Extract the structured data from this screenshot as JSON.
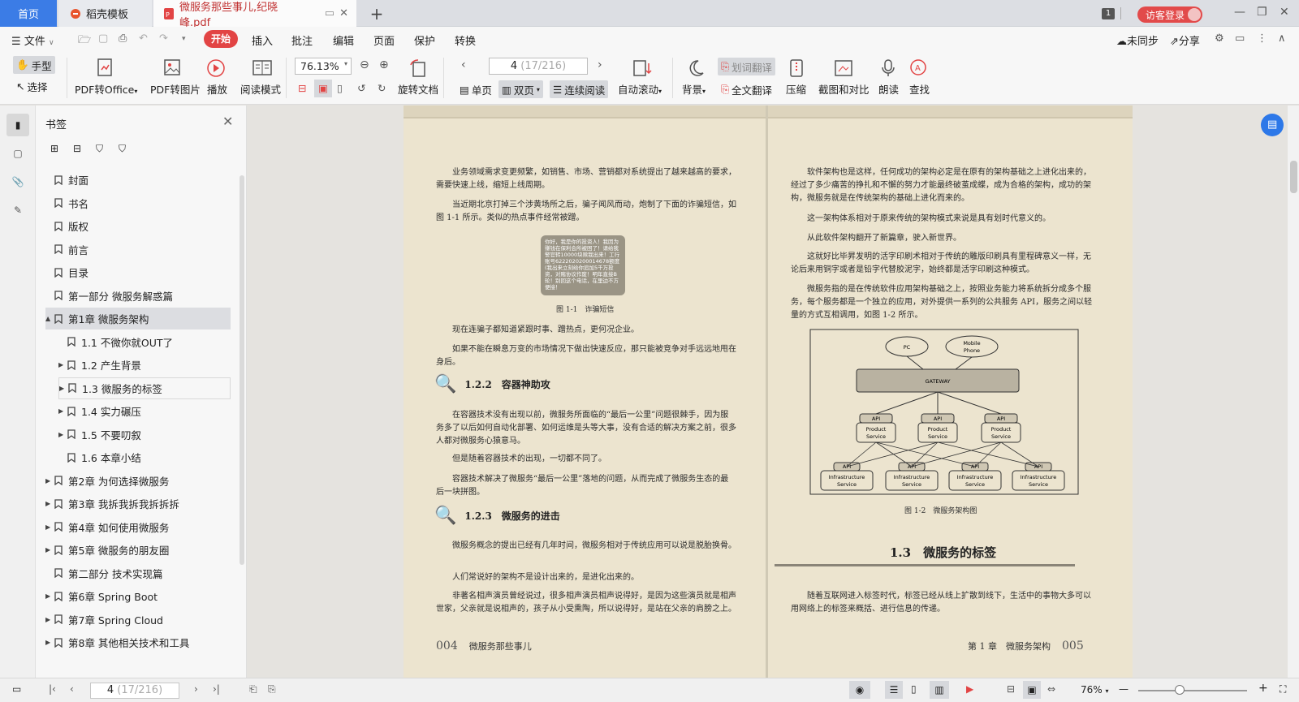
{
  "tabs": {
    "home": "首页",
    "template": "稻壳模板",
    "pdf": "微服务那些事儿,纪晓峰.pdf",
    "add": "+"
  },
  "titlebar": {
    "notif_count": "1",
    "login": "访客登录"
  },
  "menu": {
    "file": "文件",
    "start": "开始",
    "insert": "插入",
    "annotate": "批注",
    "edit": "编辑",
    "page": "页面",
    "protect": "保护",
    "convert": "转换",
    "unsync": "未同步",
    "share": "分享"
  },
  "toolbar": {
    "hand": "手型",
    "select": "选择",
    "pdf_to_office": "PDF转Office",
    "pdf_to_image": "PDF转图片",
    "play": "播放",
    "read_mode": "阅读模式",
    "zoom": "76.13%",
    "rotate": "旋转文档",
    "page_current": "4",
    "page_total": "(17/216)",
    "single": "单页",
    "double": "双页",
    "continuous": "连续阅读",
    "autoscroll": "自动滚动",
    "background": "背景",
    "word_translate": "划词翻译",
    "full_translate": "全文翻译",
    "compress": "压缩",
    "screenshot": "截图和对比",
    "read_aloud": "朗读",
    "find": "查找"
  },
  "panel": {
    "title": "书签",
    "items": [
      {
        "label": "封面",
        "level": 0,
        "expand": ""
      },
      {
        "label": "书名",
        "level": 0,
        "expand": ""
      },
      {
        "label": "版权",
        "level": 0,
        "expand": ""
      },
      {
        "label": "前言",
        "level": 0,
        "expand": ""
      },
      {
        "label": "目录",
        "level": 0,
        "expand": ""
      },
      {
        "label": "第一部分 微服务解惑篇",
        "level": 0,
        "expand": ""
      },
      {
        "label": "第1章 微服务架构",
        "level": 0,
        "expand": "▲"
      },
      {
        "label": "1.1 不微你就OUT了",
        "level": 1,
        "expand": ""
      },
      {
        "label": "1.2 产生背景",
        "level": 1,
        "expand": "▶"
      },
      {
        "label": "1.3 微服务的标签",
        "level": 1,
        "expand": "▶"
      },
      {
        "label": "1.4 实力碾压",
        "level": 1,
        "expand": "▶"
      },
      {
        "label": "1.5 不要叨叙",
        "level": 1,
        "expand": "▶"
      },
      {
        "label": "1.6 本章小结",
        "level": 1,
        "expand": ""
      },
      {
        "label": "第2章 为何选择微服务",
        "level": 0,
        "expand": "▶"
      },
      {
        "label": "第3章 我拆我拆我拆拆拆",
        "level": 0,
        "expand": "▶"
      },
      {
        "label": "第4章 如何使用微服务",
        "level": 0,
        "expand": "▶"
      },
      {
        "label": "第5章 微服务的朋友圈",
        "level": 0,
        "expand": "▶"
      },
      {
        "label": "第二部分 技术实现篇",
        "level": 0,
        "expand": ""
      },
      {
        "label": "第6章 Spring Boot",
        "level": 0,
        "expand": "▶"
      },
      {
        "label": "第7章 Spring Cloud",
        "level": 0,
        "expand": "▶"
      },
      {
        "label": "第8章 其他相关技术和工具",
        "level": 0,
        "expand": "▶"
      }
    ]
  },
  "left_page": {
    "p1": "业务领域需求变更频繁，如销售、市场、营销都对系统提出了越来越高的要求，需要快速上线，缩短上线周期。",
    "p2": "当近期北京打掉三个涉黄场所之后，骗子闻风而动，炮制了下面的诈骗短信，如图 1-1 所示。类似的热点事件经常被蹭。",
    "sms": "你好，我是你的投资人！我因为赚钱在保利会所被困了！请给我警官转10000块赎我出来！工行账号6222020200014678额度(我出来立刻给你追加5千万投资，对赌协议作废！明年直接B轮！别回这个电话，在里边不方便接！",
    "cap1": "图 1-1　诈骗短信",
    "p3": "现在连骗子都知道紧跟时事、蹭热点，更何况企业。",
    "p4": "如果不能在瞬息万变的市场情况下做出快速反应，那只能被竞争对手远远地甩在身后。",
    "h122": "1.2.2　容器神助攻",
    "p5": "在容器技术没有出现以前，微服务所面临的“最后一公里”问题很棘手，因为服务多了以后如何自动化部署、如何运维是头等大事，没有合适的解决方案之前，很多人都对微服务心猿意马。",
    "p6": "但是随着容器技术的出现，一切都不同了。",
    "p7": "容器技术解决了微服务“最后一公里”落地的问题，从而完成了微服务生态的最后一块拼图。",
    "h123": "1.2.3　微服务的进击",
    "p8": "微服务概念的提出已经有几年时间，微服务相对于传统应用可以说是脱胎换骨。",
    "p9": "人们常说好的架构不是设计出来的，是进化出来的。",
    "p10": "非著名相声演员曾经说过，很多相声演员相声说得好，是因为这些演员就是相声世家，父亲就是说相声的，孩子从小受熏陶，所以说得好，是站在父亲的肩膀之上。",
    "page_no": "004",
    "book_title": "微服务那些事儿"
  },
  "right_page": {
    "p1": "软件架构也是这样，任何成功的架构必定是在原有的架构基础之上进化出来的，经过了多少痛苦的挣扎和不懈的努力才能最终破茧成蝶，成为合格的架构，成功的架构，微服务就是在传统架构的基础上进化而来的。",
    "p2": "这一架构体系相对于原来传统的架构模式来说是具有划时代意义的。",
    "p3": "从此软件架构翻开了新篇章，驶入新世界。",
    "p4": "这就好比毕昇发明的活字印刷术相对于传统的雕版印刷具有里程碑意义一样，无论后来用铜字或者是铅字代替胶泥字，始终都是活字印刷这种模式。",
    "p5": "微服务指的是在传统软件应用架构基础之上，按照业务能力将系统拆分成多个服务，每个服务都是一个独立的应用，对外提供一系列的公共服务 API，服务之间以轻量的方式互相调用，如图 1-2 所示。",
    "diagram": {
      "pc": "PC",
      "mobile1": "Mobile",
      "mobile2": "Phone",
      "gateway": "GATEWAY",
      "api": "API",
      "product": "Product",
      "service": "Service",
      "infra": "Infrastructure"
    },
    "cap2": "图 1-2　微服务架构图",
    "h13": "1.3　微服务的标签",
    "p6": "随着互联网进入标签时代，标签已经从线上扩散到线下，生活中的事物大多可以用网络上的标签来概括、进行信息的传递。",
    "chapter": "第 1 章　微服务架构",
    "page_no": "005"
  },
  "status": {
    "page_current": "4",
    "page_total": "(17/216)",
    "zoom": "76%"
  },
  "colors": {
    "accent": "#3b7ce6",
    "red": "#e24444",
    "paper": "#ece4cf"
  }
}
